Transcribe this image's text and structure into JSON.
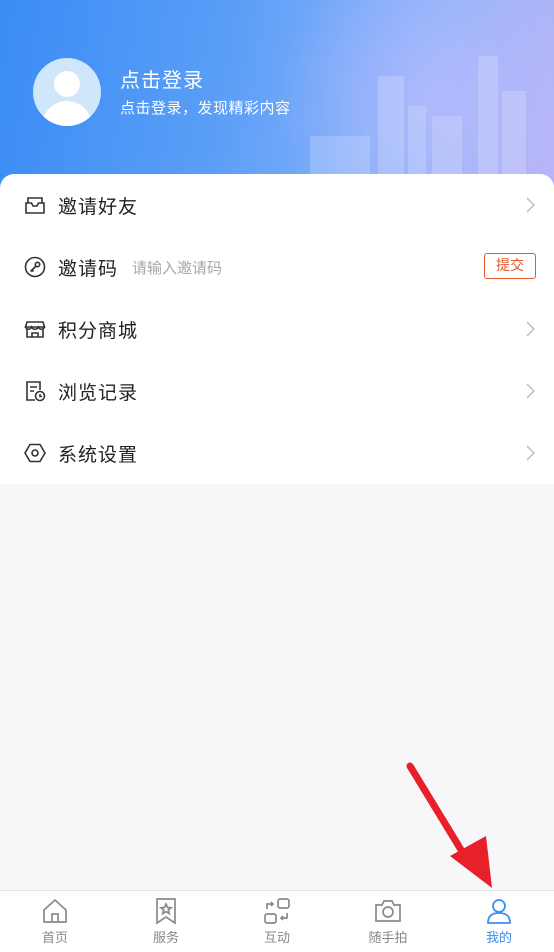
{
  "header": {
    "login_title": "点击登录",
    "login_subtitle": "点击登录，发现精彩内容"
  },
  "menu": {
    "items": [
      {
        "label": "邀请好友",
        "icon": "inbox-icon"
      },
      {
        "label": "邀请码",
        "icon": "key-icon",
        "placeholder": "请输入邀请码",
        "submit": "提交"
      },
      {
        "label": "积分商城",
        "icon": "store-icon"
      },
      {
        "label": "浏览记录",
        "icon": "history-icon"
      },
      {
        "label": "系统设置",
        "icon": "settings-hexagon-icon"
      }
    ]
  },
  "tabbar": {
    "tabs": [
      {
        "label": "首页",
        "icon": "home-icon"
      },
      {
        "label": "服务",
        "icon": "bookmark-star-icon"
      },
      {
        "label": "互动",
        "icon": "interact-icon"
      },
      {
        "label": "随手拍",
        "icon": "camera-icon"
      },
      {
        "label": "我的",
        "icon": "user-icon",
        "active": true
      }
    ]
  },
  "colors": {
    "accent": "#3b8ef0",
    "submit": "#e05a2b",
    "arrow": "#e8202a"
  }
}
